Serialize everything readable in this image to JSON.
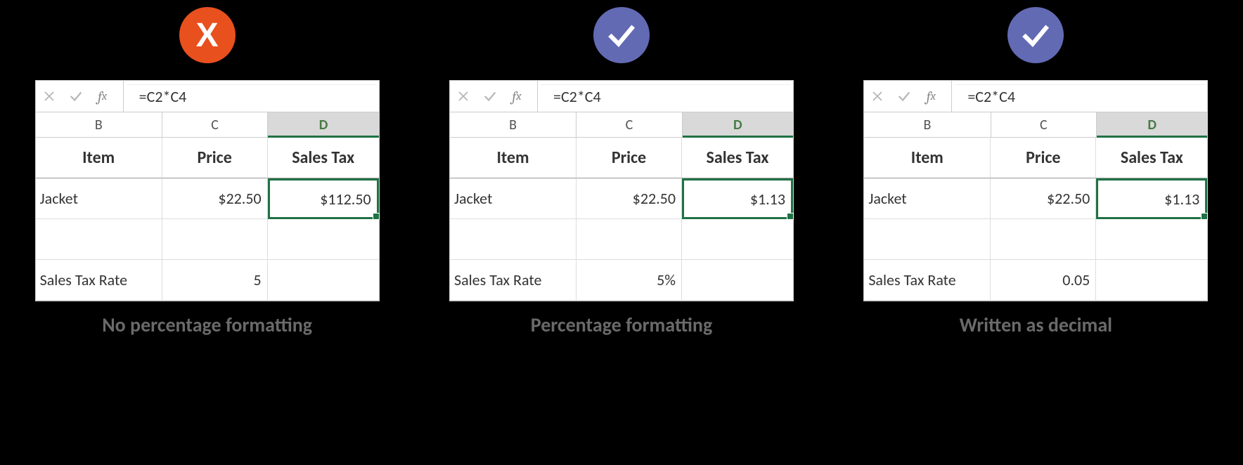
{
  "panels": [
    {
      "badge": "x",
      "formula": "=C2*C4",
      "cols": {
        "b": "B",
        "c": "C",
        "d": "D"
      },
      "headers": {
        "item": "Item",
        "price": "Price",
        "tax": "Sales Tax"
      },
      "r2": {
        "item": "Jacket",
        "price": "$22.50",
        "tax": "$112.50"
      },
      "r4": {
        "label": "Sales Tax Rate",
        "rate": "5"
      },
      "caption": "No percentage formatting"
    },
    {
      "badge": "check",
      "formula": "=C2*C4",
      "cols": {
        "b": "B",
        "c": "C",
        "d": "D"
      },
      "headers": {
        "item": "Item",
        "price": "Price",
        "tax": "Sales Tax"
      },
      "r2": {
        "item": "Jacket",
        "price": "$22.50",
        "tax": "$1.13"
      },
      "r4": {
        "label": "Sales Tax Rate",
        "rate": "5%"
      },
      "caption": "Percentage formatting"
    },
    {
      "badge": "check",
      "formula": "=C2*C4",
      "cols": {
        "b": "B",
        "c": "C",
        "d": "D"
      },
      "headers": {
        "item": "Item",
        "price": "Price",
        "tax": "Sales Tax"
      },
      "r2": {
        "item": "Jacket",
        "price": "$22.50",
        "tax": "$1.13"
      },
      "r4": {
        "label": "Sales Tax Rate",
        "rate": "0.05"
      },
      "caption": "Written as decimal"
    }
  ]
}
